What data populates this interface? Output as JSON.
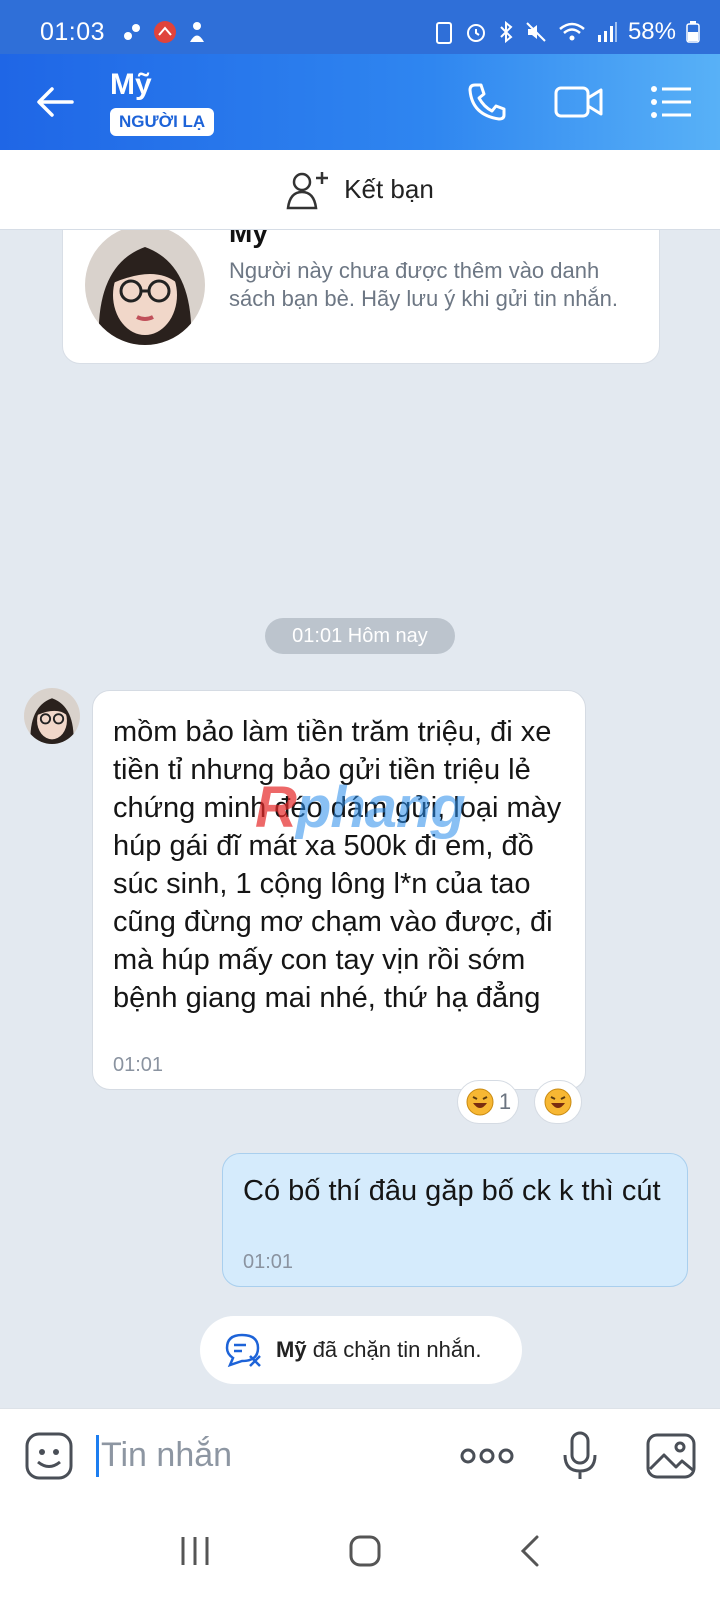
{
  "status_bar": {
    "time": "01:03",
    "battery": "58%"
  },
  "header": {
    "title": "Mỹ",
    "badge": "NGƯỜI LẠ"
  },
  "friend_bar": {
    "label": "Kết bạn"
  },
  "stranger_card": {
    "name": "Mỹ",
    "description": "Người này chưa được thêm vào danh sách bạn bè. Hãy lưu ý khi gửi tin nhắn."
  },
  "date_separator": "01:01 Hôm nay",
  "messages": [
    {
      "direction": "incoming",
      "text": "mồm bảo làm tiền trăm triệu, đi xe tiền tỉ nhưng bảo gửi tiền triệu lẻ chứng minh đéo dám gửi, loại mày húp gái đĩ mát xa 500k đi em, đồ súc sinh, 1 cộng lông l*n của tao cũng đừng mơ chạm vào được, đi mà húp mấy con tay vịn rồi sớm bệnh giang mai nhé, thứ hạ đẳng",
      "time": "01:01",
      "reaction_count": "1"
    },
    {
      "direction": "outgoing",
      "text": "Có bố thí đâu  găp bố ck  k thì cút",
      "time": "01:01"
    }
  ],
  "watermark": {
    "a": "R",
    "b": "phang"
  },
  "blocked_notice": {
    "name": "Mỹ",
    "text": "đã chặn tin nhắn."
  },
  "composer": {
    "placeholder": "Tin nhắn"
  },
  "colors": {
    "header": "#2f86f0",
    "outgoing_bubble": "#d5ebfc",
    "background": "#e3e9f0"
  }
}
